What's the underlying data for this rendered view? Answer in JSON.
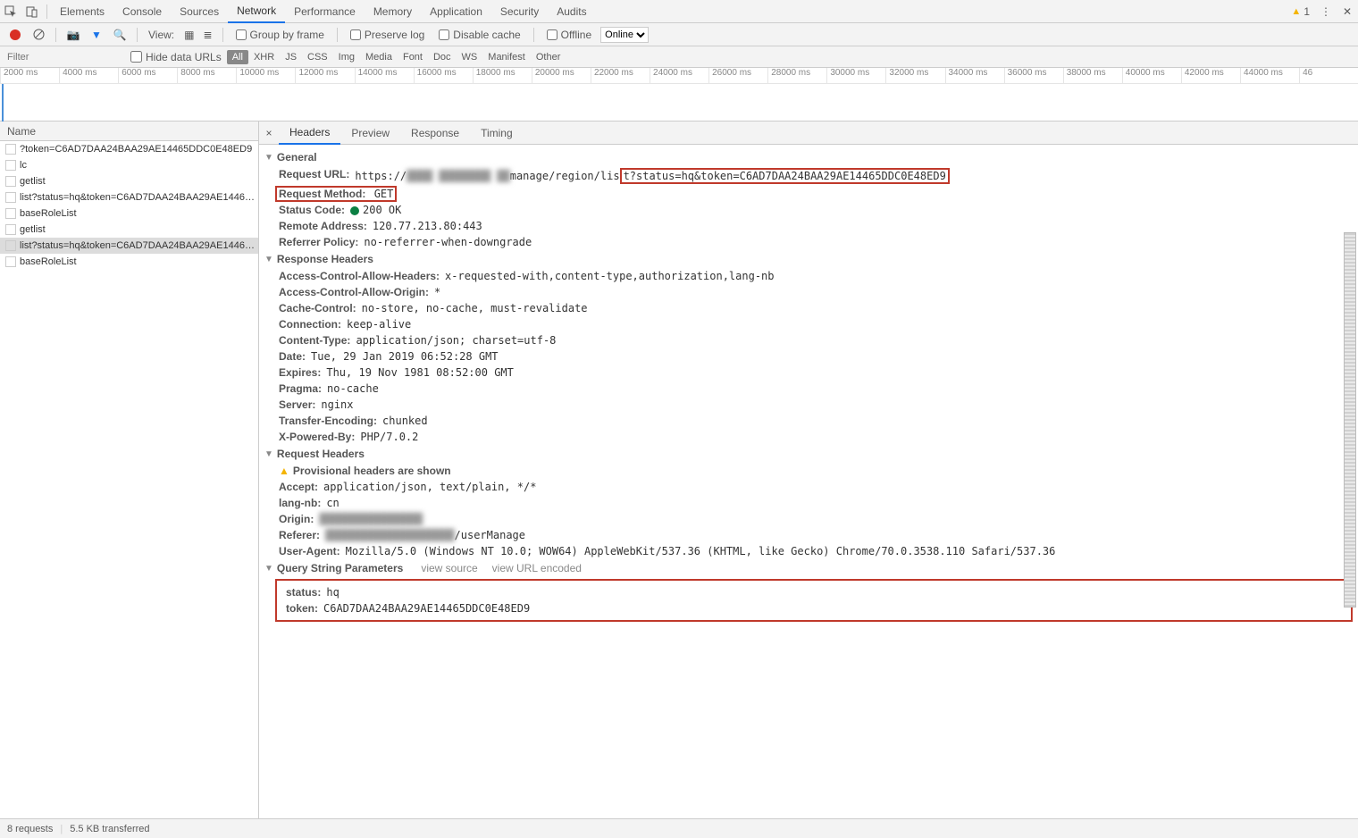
{
  "topTabs": {
    "elements": "Elements",
    "console": "Console",
    "sources": "Sources",
    "network": "Network",
    "performance": "Performance",
    "memory": "Memory",
    "application": "Application",
    "security": "Security",
    "audits": "Audits",
    "warnCount": "1"
  },
  "netToolbar": {
    "viewLabel": "View:",
    "groupByFrame": "Group by frame",
    "preserveLog": "Preserve log",
    "disableCache": "Disable cache",
    "offline": "Offline",
    "throttle": "Online"
  },
  "filterBar": {
    "placeholder": "Filter",
    "hideDataUrls": "Hide data URLs",
    "types": {
      "all": "All",
      "xhr": "XHR",
      "js": "JS",
      "css": "CSS",
      "img": "Img",
      "media": "Media",
      "font": "Font",
      "doc": "Doc",
      "ws": "WS",
      "manifest": "Manifest",
      "other": "Other"
    }
  },
  "timeline": {
    "ticks": [
      "2000 ms",
      "4000 ms",
      "6000 ms",
      "8000 ms",
      "10000 ms",
      "12000 ms",
      "14000 ms",
      "16000 ms",
      "18000 ms",
      "20000 ms",
      "22000 ms",
      "24000 ms",
      "26000 ms",
      "28000 ms",
      "30000 ms",
      "32000 ms",
      "34000 ms",
      "36000 ms",
      "38000 ms",
      "40000 ms",
      "42000 ms",
      "44000 ms",
      "46"
    ]
  },
  "requests": {
    "header": "Name",
    "items": [
      "?token=C6AD7DAA24BAA29AE14465DDC0E48ED9",
      "lc",
      "getlist",
      "list?status=hq&token=C6AD7DAA24BAA29AE1446…",
      "baseRoleList",
      "getlist",
      "list?status=hq&token=C6AD7DAA24BAA29AE1446…",
      "baseRoleList"
    ],
    "selectedIndex": 6
  },
  "detailTabs": {
    "headers": "Headers",
    "preview": "Preview",
    "response": "Response",
    "timing": "Timing"
  },
  "general": {
    "title": "General",
    "requestUrlLabel": "Request URL:",
    "requestUrlPrefix": "https://",
    "requestUrlMid": "manage/region/lis",
    "requestUrlQuery": "t?status=hq&token=C6AD7DAA24BAA29AE14465DDC0E48ED9",
    "requestMethodLabel": "Request Method:",
    "requestMethod": "GET",
    "statusCodeLabel": "Status Code:",
    "statusCode": "200 OK",
    "remoteAddressLabel": "Remote Address:",
    "remoteAddress": "120.77.213.80:443",
    "referrerPolicyLabel": "Referrer Policy:",
    "referrerPolicy": "no-referrer-when-downgrade"
  },
  "responseHeaders": {
    "title": "Response Headers",
    "items": [
      {
        "k": "Access-Control-Allow-Headers:",
        "v": "x-requested-with,content-type,authorization,lang-nb"
      },
      {
        "k": "Access-Control-Allow-Origin:",
        "v": "*"
      },
      {
        "k": "Cache-Control:",
        "v": "no-store, no-cache, must-revalidate"
      },
      {
        "k": "Connection:",
        "v": "keep-alive"
      },
      {
        "k": "Content-Type:",
        "v": "application/json; charset=utf-8"
      },
      {
        "k": "Date:",
        "v": "Tue, 29 Jan 2019 06:52:28 GMT"
      },
      {
        "k": "Expires:",
        "v": "Thu, 19 Nov 1981 08:52:00 GMT"
      },
      {
        "k": "Pragma:",
        "v": "no-cache"
      },
      {
        "k": "Server:",
        "v": "nginx"
      },
      {
        "k": "Transfer-Encoding:",
        "v": "chunked"
      },
      {
        "k": "X-Powered-By:",
        "v": "PHP/7.0.2"
      }
    ]
  },
  "requestHeaders": {
    "title": "Request Headers",
    "provisional": "Provisional headers are shown",
    "accept": {
      "k": "Accept:",
      "v": "application/json, text/plain, */*"
    },
    "langNb": {
      "k": "lang-nb:",
      "v": "cn"
    },
    "origin": {
      "k": "Origin:",
      "v": ""
    },
    "referer": {
      "k": "Referer:",
      "v": "/userManage"
    },
    "userAgent": {
      "k": "User-Agent:",
      "v": "Mozilla/5.0 (Windows NT 10.0; WOW64) AppleWebKit/537.36 (KHTML, like Gecko) Chrome/70.0.3538.110 Safari/537.36"
    }
  },
  "queryString": {
    "title": "Query String Parameters",
    "viewSource": "view source",
    "viewUrlEncoded": "view URL encoded",
    "status": {
      "k": "status:",
      "v": "hq"
    },
    "token": {
      "k": "token:",
      "v": "C6AD7DAA24BAA29AE14465DDC0E48ED9"
    }
  },
  "statusBar": {
    "requests": "8 requests",
    "transferred": "5.5 KB transferred"
  }
}
